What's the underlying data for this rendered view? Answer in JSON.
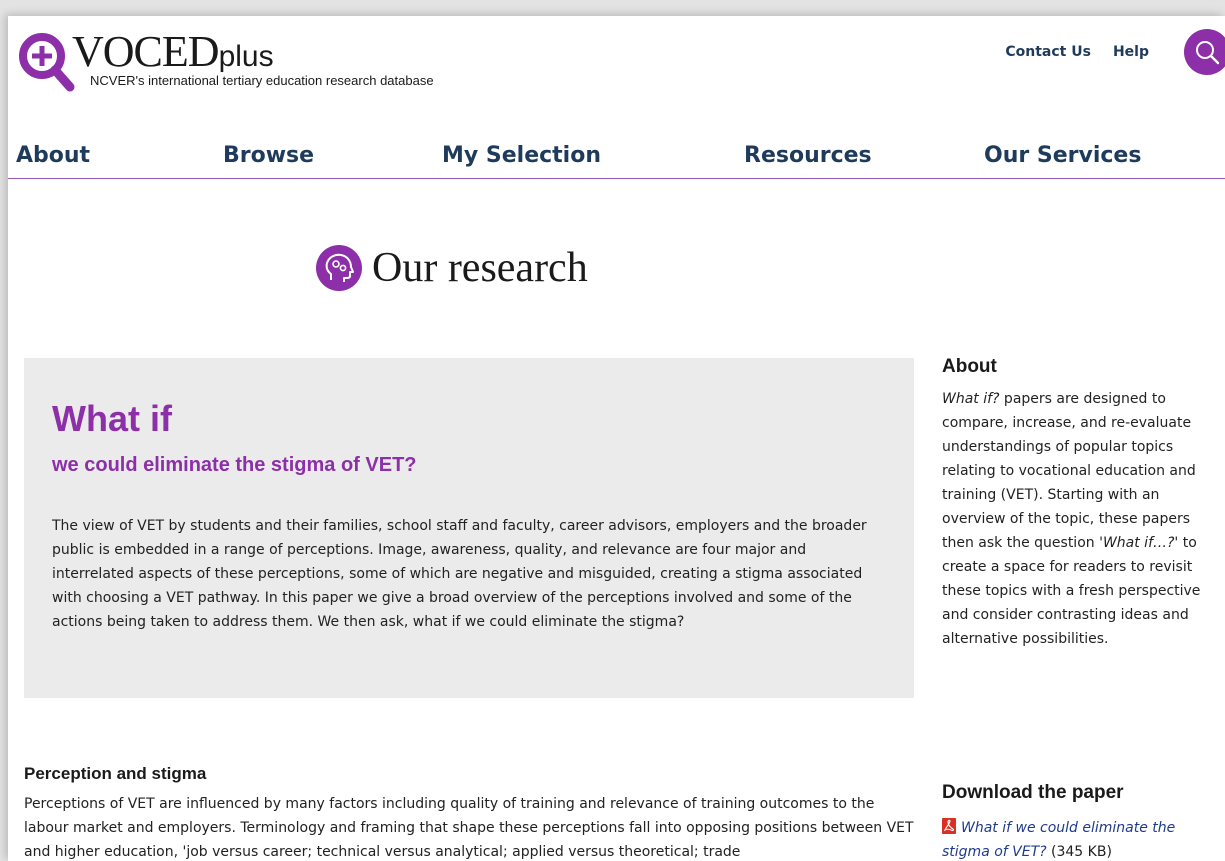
{
  "colors": {
    "brand_purple": "#8c2fa8",
    "nav_navy": "#1f3b5c",
    "panel_grey": "#ebebeb",
    "link_blue": "#1f3b8c"
  },
  "header": {
    "logo_main": "VOCED",
    "logo_suffix": "plus",
    "tagline": "NCVER's international tertiary education research database",
    "links": {
      "contact": "Contact Us",
      "help": "Help"
    },
    "search_icon": "search-icon"
  },
  "nav": {
    "about": "About",
    "browse": "Browse",
    "my_selection": "My Selection",
    "resources": "Resources",
    "services": "Our Services"
  },
  "page": {
    "icon": "head-gears-icon",
    "title": "Our research"
  },
  "panel": {
    "title": "What if",
    "subtitle": "we could eliminate the stigma of VET?",
    "body": "The view of VET by students and their families, school staff and faculty, career advisors, employers and the broader public is embedded in a range of perceptions. Image, awareness, quality, and relevance are four major and interrelated aspects of these perceptions, some of which are negative and misguided, creating a stigma associated with choosing a VET pathway. In this paper we give a broad overview of the perceptions involved and some of the actions being taken to address them. We then ask, what if we could eliminate the stigma?"
  },
  "sidebar": {
    "about_heading": "About",
    "about_part1": "What if?",
    "about_part2": " papers are designed to compare, increase, and re-evaluate understandings of popular topics relating to vocational education and training (VET). Starting with an overview of the topic, these papers then ask the question ",
    "about_part3": "'What if…?'",
    "about_part4": " to create a space for readers to revisit these topics with a fresh perspective and consider contrasting ideas and alternative possibilities.",
    "download_heading": "Download the paper",
    "download_link": "What if we could eliminate the stigma of VET?",
    "download_size": " (345 KB)"
  },
  "section": {
    "heading": "Perception and stigma",
    "body": "Perceptions of VET are influenced by many factors including quality of training and relevance of training outcomes to the labour market and employers. Terminology and framing that shape these perceptions fall into opposing positions between VET and higher education, 'job versus career; technical versus analytical; applied versus theoretical; trade"
  }
}
